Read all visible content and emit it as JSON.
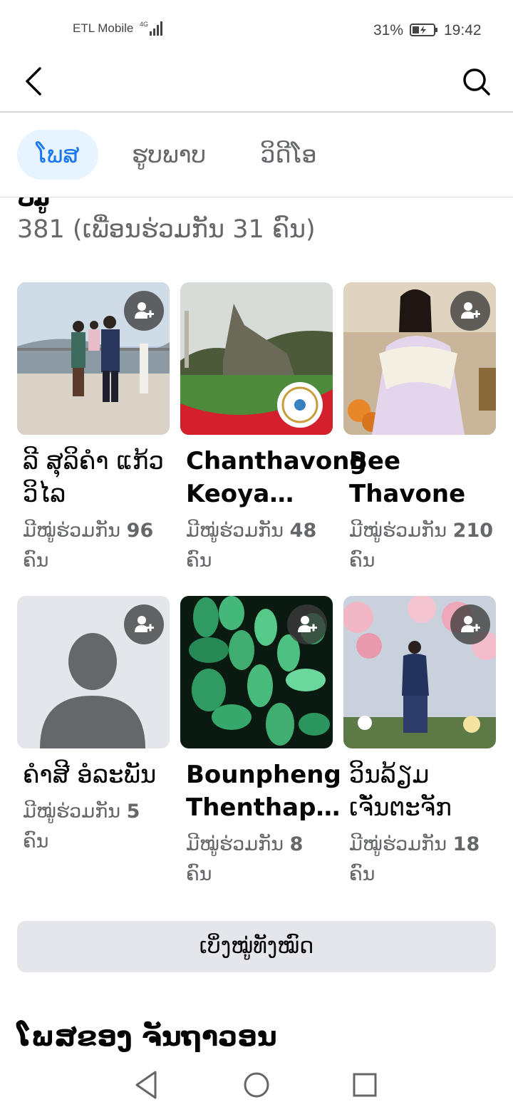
{
  "status_bar": {
    "carrier": "ETL Mobile",
    "network": "4G",
    "battery": "31%",
    "time": "19:42"
  },
  "tabs": [
    {
      "label": "ໂພສ",
      "active": true
    },
    {
      "label": "ຮູບພາບ",
      "active": false
    },
    {
      "label": "ວິດີໂອ",
      "active": false
    }
  ],
  "friends": {
    "heading": "ໝູ່",
    "count_text": "381 (ເພື່ອນຮ່ວມກັນ 31 ຄົນ)",
    "cards": [
      {
        "name": "ລີ ສຸລິຄຳ ແກ້ວວິໄລ",
        "mutual_prefix": "ມີໝູ່ຮ່ວມກັນ ",
        "mutual_count": "96",
        "mutual_suffix": " ຄົນ"
      },
      {
        "name": "Chanthavong Keoya…",
        "mutual_prefix": "ມີໝູ່ຮ່ວມກັນ ",
        "mutual_count": "48",
        "mutual_suffix": " ຄົນ"
      },
      {
        "name": "Bee Thavone",
        "mutual_prefix": "ມີໝູ່ຮ່ວມກັນ ",
        "mutual_count": "210",
        "mutual_suffix": " ຄົນ"
      },
      {
        "name": "ຄຳສີ ອໍລະພັນ",
        "mutual_prefix": "ມີໝູ່ຮ່ວມກັນ ",
        "mutual_count": "5",
        "mutual_suffix": " ຄົນ"
      },
      {
        "name": "Bounpheng Thenthap…",
        "mutual_prefix": "ມີໝູ່ຮ່ວມກັນ ",
        "mutual_count": "8",
        "mutual_suffix": " ຄົນ"
      },
      {
        "name": "ວິນລ້ຽມ ເຈັ່ນຕະຈັກ",
        "mutual_prefix": "ມີໝູ່ຮ່ວມກັນ ",
        "mutual_count": "18",
        "mutual_suffix": " ຄົນ"
      }
    ]
  },
  "see_all_label": "ເບິ່ງໝູ່ທັງໝົດ",
  "posts_heading": "ໂພສຂອງ ຈັນຖາວອນ",
  "icons": {
    "back": "back-arrow-icon",
    "search": "search-icon",
    "add_friend": "add-friend-icon",
    "nav_back": "nav-back-icon",
    "nav_home": "nav-home-icon",
    "nav_recents": "nav-recents-icon"
  },
  "colors": {
    "accent": "#1877f2",
    "tab_active_bg": "#e7f3ff",
    "secondary_text": "#65676b",
    "button_bg": "#e4e6eb"
  }
}
